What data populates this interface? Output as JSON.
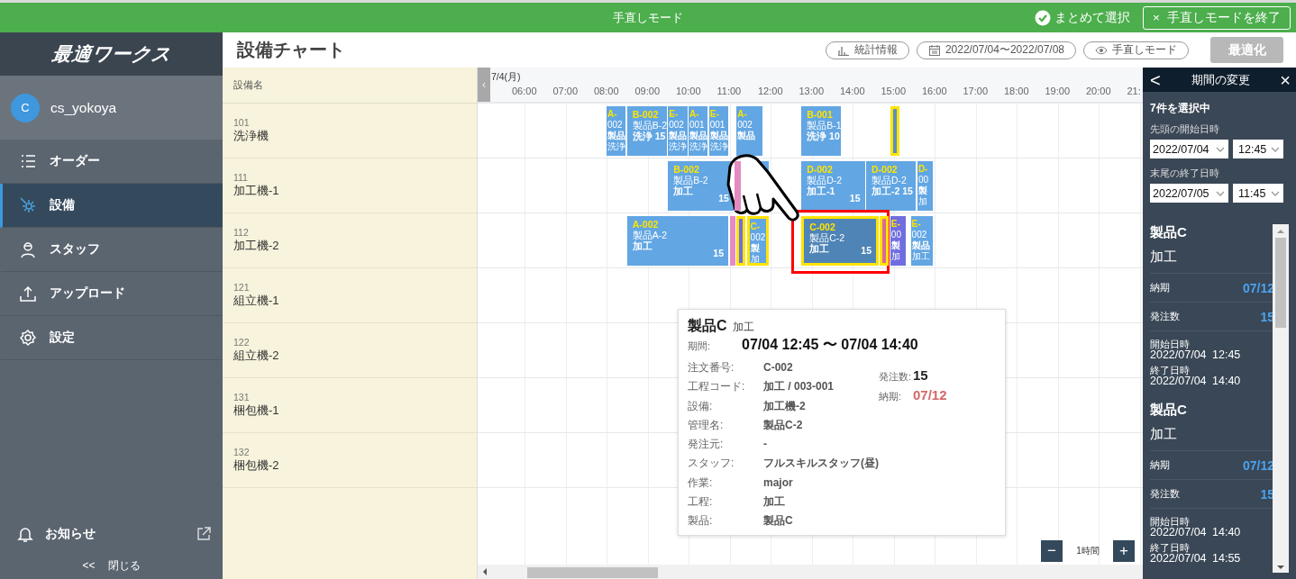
{
  "mode_bar": {
    "title": "手直しモード",
    "bulk_select": {
      "label": "まとめて選択",
      "checked": true
    },
    "exit_button": {
      "icon": "×",
      "label": "手直しモードを終了"
    }
  },
  "sidebar": {
    "logo": "最適ワークス",
    "user": {
      "initial": "C",
      "name": "cs_yokoya"
    },
    "items": [
      {
        "kind": "list",
        "label": "オーダー",
        "selected": false
      },
      {
        "kind": "equipment",
        "label": "設備",
        "selected": true
      },
      {
        "kind": "staff",
        "label": "スタッフ",
        "selected": false
      },
      {
        "kind": "upload",
        "label": "アップロード",
        "selected": false
      },
      {
        "kind": "settings",
        "label": "設定",
        "selected": false
      }
    ],
    "notice": "お知らせ",
    "collapse": {
      "icon": "<<",
      "label": "閉じる"
    }
  },
  "header": {
    "title": "設備チャート",
    "buttons": [
      {
        "kind": "stats",
        "label": "統計情報"
      },
      {
        "kind": "date",
        "label": "2022/07/04〜2022/07/08"
      },
      {
        "kind": "eye",
        "label": "手直しモード"
      }
    ],
    "optimize": {
      "label": "最適化",
      "disabled": true
    }
  },
  "chart": {
    "resource_header": "設備名",
    "scroll_left": "‹",
    "date": "7/4(月)",
    "hours": [
      "06:00",
      "07:00",
      "08:00",
      "09:00",
      "10:00",
      "11:00",
      "12:00",
      "13:00",
      "14:00",
      "15:00",
      "16:00",
      "17:00",
      "18:00",
      "19:00",
      "20:00",
      "21:"
    ],
    "resources": [
      {
        "code": "101",
        "name": "洗浄機",
        "tasks": [
          {
            "lines": [
              "A-",
              "002",
              "製品",
              "洗浄"
            ],
            "color": "#62a6e3",
            "selected": false,
            "highlighted": false
          },
          {
            "lines": [
              "B-002",
              "製品B-2",
              "洗浄 15"
            ],
            "color": "#62a6e3",
            "selected": false,
            "highlighted": false
          },
          {
            "lines": [
              "E-",
              "002",
              "製品",
              "洗浄"
            ],
            "color": "#62a6e3",
            "selected": false,
            "highlighted": false
          },
          {
            "lines": [
              "A-",
              "001",
              "製品",
              "洗浄"
            ],
            "color": "#62a6e3",
            "selected": false,
            "highlighted": false
          },
          {
            "lines": [
              "E-",
              "001",
              "製品",
              "洗浄"
            ],
            "color": "#62a6e3",
            "selected": false,
            "highlighted": false
          },
          {
            "lines": [
              "A-",
              "002",
              "製品"
            ],
            "color": "#62a6e3",
            "selected": false,
            "highlighted": false
          },
          {
            "lines": [
              "B-001",
              "製品B-1",
              "洗浄 10"
            ],
            "color": "#62a6e3",
            "selected": false,
            "highlighted": false
          },
          {
            "color": "#5b8fc0",
            "selected": true,
            "highlighted": false
          }
        ]
      },
      {
        "code": "111",
        "name": "加工機-1",
        "tasks": [
          {
            "lines": [
              "B-002",
              "製品B-2",
              "加工"
            ],
            "qty": "15",
            "color": "#62a6e3",
            "selected": false,
            "highlighted": false
          },
          {
            "color": "#e48bc0",
            "selected": false,
            "highlighted": false
          },
          {
            "color": "#62a6e3",
            "selected": false,
            "highlighted": false
          },
          {
            "lines": [
              "D-002",
              "製品D-2",
              "加工-1"
            ],
            "qty": "15",
            "color": "#62a6e3",
            "selected": false,
            "highlighted": false
          },
          {
            "lines": [
              "D-002",
              "製品D-2",
              "加工-2 15"
            ],
            "color": "#62a6e3",
            "selected": false,
            "highlighted": false
          },
          {
            "lines": [
              "D-",
              "00",
              "製",
              "加"
            ],
            "color": "#62a6e3",
            "selected": false,
            "highlighted": false
          }
        ]
      },
      {
        "code": "112",
        "name": "加工機-2",
        "tasks": [
          {
            "lines": [
              "A-002",
              "製品A-2",
              "加工"
            ],
            "qty": "15",
            "color": "#62a6e3",
            "selected": false,
            "highlighted": false
          },
          {
            "color": "#e48bc0",
            "selected": false,
            "highlighted": false
          },
          {
            "color": "#6f6ee0",
            "selected": true,
            "highlighted": false
          },
          {
            "lines": [
              "C-",
              "002",
              "製",
              "加"
            ],
            "color": "#62a6e3",
            "selected": true,
            "highlighted": false
          },
          {
            "lines": [
              "C-002",
              "製品C-2",
              "加工"
            ],
            "qty": "15",
            "color": "#4f84b6",
            "selected": true,
            "highlighted": true
          },
          {
            "color": "#d96a9a",
            "selected": true,
            "highlighted": false
          },
          {
            "lines": [
              "E-",
              "00",
              "製",
              "加"
            ],
            "color": "#6f6ee0",
            "selected": false,
            "highlighted": false
          },
          {
            "lines": [
              "E-",
              "002",
              "製品",
              "加工"
            ],
            "color": "#62a6e3",
            "selected": false,
            "highlighted": false
          }
        ]
      },
      {
        "code": "121",
        "name": "組立機-1"
      },
      {
        "code": "122",
        "name": "組立機-2"
      },
      {
        "code": "131",
        "name": "梱包機-1"
      },
      {
        "code": "132",
        "name": "梱包機-2"
      }
    ],
    "tooltip": {
      "title": "製品C",
      "subtitle": "加工",
      "period_label": "期間:",
      "period": "07/04 12:45 〜 07/04 14:40",
      "fields": [
        {
          "label": "注文番号:",
          "value": "C-002"
        },
        {
          "label": "工程コード:",
          "value": "加工 / 003-001"
        },
        {
          "label": "設備:",
          "value": "加工機-2"
        },
        {
          "label": "管理名:",
          "value": "製品C-2"
        },
        {
          "label": "発注元:",
          "value": "-"
        },
        {
          "label": "スタッフ:",
          "value": "フルスキルスタッフ(昼)"
        },
        {
          "label": "作業:",
          "value": "major"
        },
        {
          "label": "工程:",
          "value": "加工"
        },
        {
          "label": "製品:",
          "value": "製品C"
        }
      ],
      "quantity_label": "発注数:",
      "quantity": "15",
      "due_label": "納期:",
      "due": "07/12"
    },
    "zoom": {
      "minus": "−",
      "label": "1時間",
      "plus": "+"
    }
  },
  "panel": {
    "title": "期間の変更",
    "back": "<",
    "close": "×",
    "selection": "7件を選択中",
    "start": {
      "label": "先頭の開始日時",
      "date": "2022/07/04",
      "time": "12:45"
    },
    "end": {
      "label": "末尾の終了日時",
      "date": "2022/07/05",
      "time": "11:45"
    },
    "cards": [
      {
        "title": "製品C",
        "process": "加工",
        "due_label": "納期",
        "due": "07/12",
        "qty_label": "発注数",
        "qty": "15",
        "start_label": "開始日時",
        "start": "2022/07/04 12:45",
        "end_label": "終了日時",
        "end": "2022/07/04 14:40"
      },
      {
        "title": "製品C",
        "process": "加工",
        "due_label": "納期",
        "due": "07/12",
        "qty_label": "発注数",
        "qty": "15",
        "start_label": "開始日時",
        "start": "2022/07/04 14:40",
        "end_label": "終了日時",
        "end": "2022/07/04 14:55"
      }
    ]
  }
}
